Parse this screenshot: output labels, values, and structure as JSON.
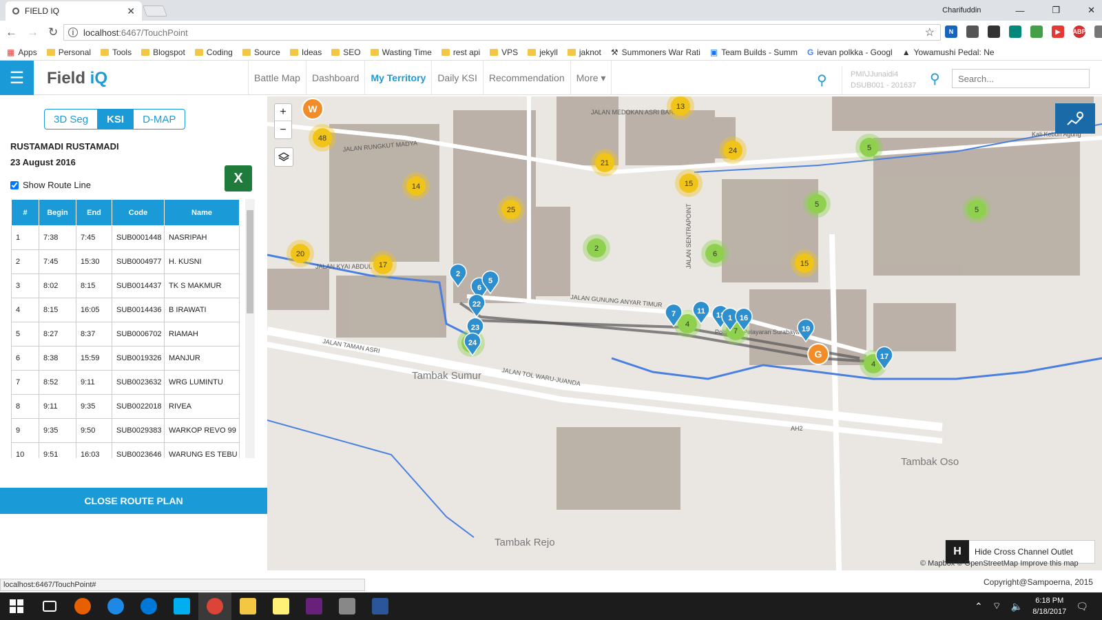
{
  "browser": {
    "tab_title": "FIELD IQ",
    "url_host": "localhost",
    "url_rest": ":6467/TouchPoint",
    "user": "Charifuddin",
    "bookmarks": [
      "Apps",
      "Personal",
      "Tools",
      "Blogspot",
      "Coding",
      "Source",
      "Ideas",
      "SEO",
      "Wasting Time",
      "rest api",
      "VPS",
      "jekyll",
      "jaknot",
      "Summoners War Rati",
      "Team Builds - Summ",
      "ievan polkka - Googl",
      "Yowamushi Pedal: Ne"
    ]
  },
  "header": {
    "logo_main": "Field ",
    "logo_accent": "iQ",
    "nav": [
      "Battle Map",
      "Dashboard",
      "My Territory",
      "Daily KSI",
      "Recommendation",
      "More ▾"
    ],
    "user_line1": "PMI\\JJunaidi4",
    "user_line2": "DSUB001 - 201637",
    "search_placeholder": "Search..."
  },
  "panel": {
    "segments": [
      "3D Seg",
      "KSI",
      "D-MAP"
    ],
    "salesman": "RUSTAMADI RUSTAMADI",
    "date": "23 August 2016",
    "route_label": "Show Route Line",
    "columns": [
      "#",
      "Begin",
      "End",
      "Code",
      "Name"
    ],
    "rows": [
      [
        "1",
        "7:38",
        "7:45",
        "SUB0001448",
        "NASRIPAH"
      ],
      [
        "2",
        "7:45",
        "15:30",
        "SUB0004977",
        "H. KUSNI"
      ],
      [
        "3",
        "8:02",
        "8:15",
        "SUB0014437",
        "TK S MAKMUR"
      ],
      [
        "4",
        "8:15",
        "16:05",
        "SUB0014436",
        "B IRAWATI"
      ],
      [
        "5",
        "8:27",
        "8:37",
        "SUB0006702",
        "RIAMAH"
      ],
      [
        "6",
        "8:38",
        "15:59",
        "SUB0019326",
        "MANJUR"
      ],
      [
        "7",
        "8:52",
        "9:11",
        "SUB0023632",
        "WRG LUMINTU"
      ],
      [
        "8",
        "9:11",
        "9:35",
        "SUB0022018",
        "RIVEA"
      ],
      [
        "9",
        "9:35",
        "9:50",
        "SUB0029383",
        "WARKOP REVO 99"
      ],
      [
        "10",
        "9:51",
        "16:03",
        "SUB0023646",
        "WARUNG ES TEBU"
      ]
    ],
    "close_label": "CLOSE ROUTE PLAN"
  },
  "map": {
    "labels": [
      "JALAN RUNGKUT MADYA",
      "JALAN MEDOKAN ASRI BARAT",
      "JALAN GUNUNG ANYAR TIMUR",
      "JALAN TAMAN ASRI",
      "JALAN TOL WARU-JUANDA",
      "JALAN KYAI ABDUL",
      "Tambak Sumur",
      "Tambak Oso",
      "Tambak Rejo",
      "AH2",
      "Politeknik Pelayaran Surabaya",
      "JALAN SENTRAPOINT",
      "Kali Kebon Agung"
    ],
    "clusters": [
      {
        "n": "13",
        "c": "#f0c419"
      },
      {
        "n": "48",
        "c": "#f0c419"
      },
      {
        "n": "21",
        "c": "#f0c419"
      },
      {
        "n": "24",
        "c": "#f0c419"
      },
      {
        "n": "15",
        "c": "#f0c419"
      },
      {
        "n": "14",
        "c": "#f0c419"
      },
      {
        "n": "25",
        "c": "#f0c419"
      },
      {
        "n": "20",
        "c": "#f0c419"
      },
      {
        "n": "17",
        "c": "#f0c419"
      },
      {
        "n": "15",
        "c": "#f0c419"
      },
      {
        "n": "5",
        "c": "#8fd14f"
      },
      {
        "n": "5",
        "c": "#8fd14f"
      },
      {
        "n": "5",
        "c": "#8fd14f"
      },
      {
        "n": "2",
        "c": "#8fd14f"
      },
      {
        "n": "6",
        "c": "#8fd14f"
      },
      {
        "n": "4",
        "c": "#8fd14f"
      },
      {
        "n": "7",
        "c": "#8fd14f"
      },
      {
        "n": "4",
        "c": "#8fd14f"
      },
      {
        "n": "24",
        "c": "#8fd14f"
      }
    ],
    "pins": [
      "2",
      "6",
      "5",
      "22",
      "23",
      "24",
      "7",
      "11",
      "13",
      "1",
      "16",
      "19",
      "17"
    ],
    "special": [
      {
        "n": "W",
        "c": "#f28c28"
      },
      {
        "n": "G",
        "c": "#f28c28"
      }
    ],
    "hide_label": "Hide Cross Channel Outlet",
    "hide_key": "H",
    "attribution": "© Mapbox © OpenStreetMap Improve this map"
  },
  "status_url": "localhost:6467/TouchPoint#",
  "copyright": "Copyright@Sampoerna, 2015",
  "clock": {
    "time": "6:18 PM",
    "date": "8/18/2017"
  }
}
